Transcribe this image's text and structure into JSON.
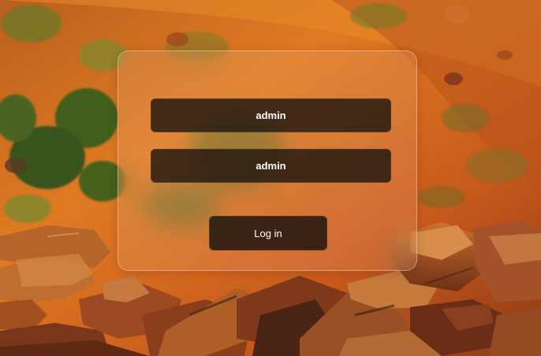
{
  "login": {
    "username_value": "admin",
    "password_value": "admin",
    "login_label": "Log in"
  },
  "colors": {
    "panel_tint": "#ffffff",
    "field_bg": "#19120e",
    "text": "#ffffff"
  }
}
